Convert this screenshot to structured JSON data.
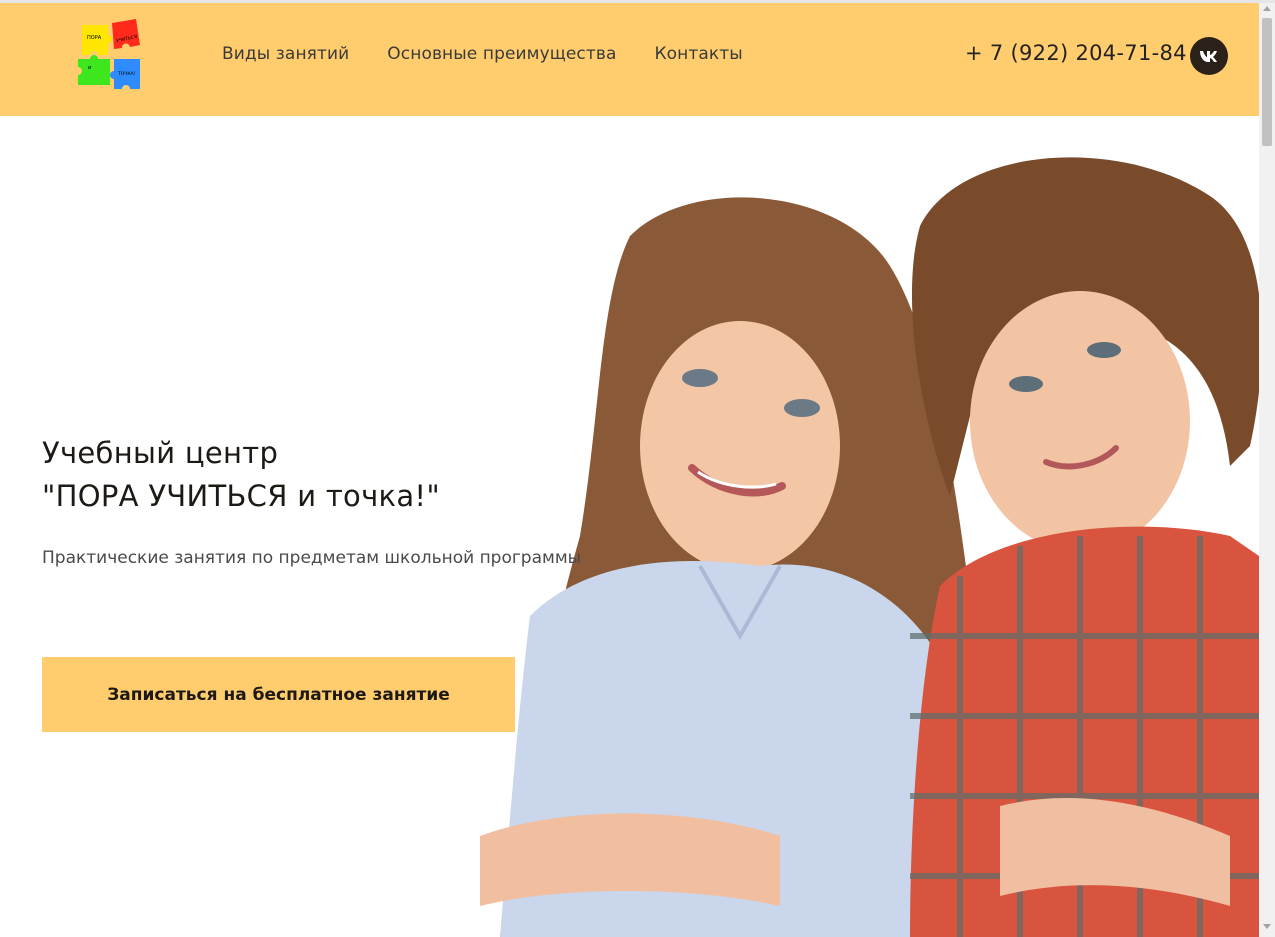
{
  "header": {
    "logo_words": [
      "ПОРА",
      "УЧИТЬСЯ",
      "и",
      "ТОЧКА!"
    ],
    "nav": [
      {
        "label": "Виды занятий"
      },
      {
        "label": "Основные преимущества"
      },
      {
        "label": "Контакты"
      }
    ],
    "phone": "+ 7 (922) 204-71-84",
    "social_icon": "vk-icon"
  },
  "hero": {
    "title_line1": "Учебный центр",
    "title_line2": "\"ПОРА УЧИТЬСЯ и точка!\"",
    "subtitle": "Практические занятия по предметам школьной программы",
    "cta_label": "Записаться на бесплатное занятие",
    "image_desc_icon": "children-photo"
  },
  "colors": {
    "accent": "#ffcd6d",
    "dark": "#2a2118",
    "text": "#1d1a15"
  }
}
